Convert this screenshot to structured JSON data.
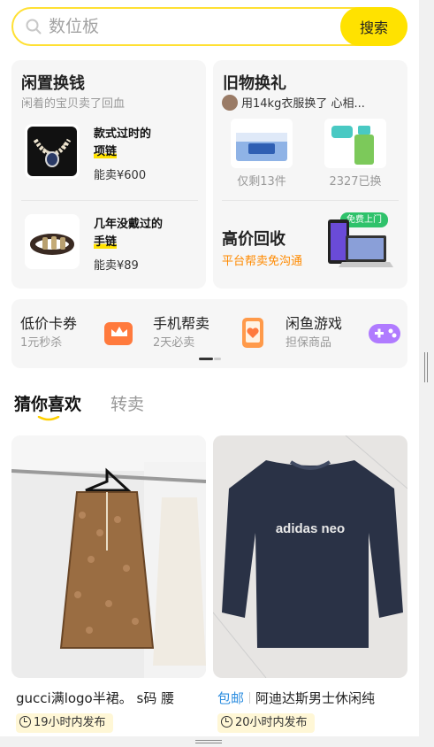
{
  "search": {
    "placeholder": "数位板",
    "button": "搜索"
  },
  "idle": {
    "title": "闲置换钱",
    "subtitle": "闲着的宝贝卖了回血",
    "items": [
      {
        "name_a": "款式过时的",
        "name_b": "项链",
        "price": "能卖¥600"
      },
      {
        "name_a": "几年没戴过的",
        "name_b": "手链",
        "price": "能卖¥89"
      }
    ]
  },
  "swap": {
    "title": "旧物换礼",
    "line": "用14kg衣服换了 心相...",
    "items": [
      {
        "caption": "仅剩13件"
      },
      {
        "caption": "2327已换"
      }
    ],
    "recycle_title": "高价回收",
    "recycle_sub": "平台帮卖免沟通",
    "badge": "免费上门"
  },
  "services": [
    {
      "title": "低价卡券",
      "sub": "1元秒杀",
      "icon": "crown-card-icon",
      "color": "#ff7a3d"
    },
    {
      "title": "手机帮卖",
      "sub": "2天必卖",
      "icon": "phone-heart-icon",
      "color": "#ff9a4a"
    },
    {
      "title": "闲鱼游戏",
      "sub": "担保商品",
      "icon": "gamepad-icon",
      "color": "#a36bff"
    }
  ],
  "tabs": {
    "active": "猜你喜欢",
    "inactive": "转卖"
  },
  "feed": [
    {
      "title": "gucci满logo半裙。 s码 腰",
      "time": "19小时内发布"
    },
    {
      "tag": "包邮",
      "title": "阿迪达斯男士休闲纯",
      "time": "20小时内发布",
      "print": "adidas neo"
    }
  ],
  "colors": {
    "accent": "#ffe200",
    "orange": "#ff8a00",
    "green": "#2fc26b",
    "blue": "#2f8fe0"
  }
}
